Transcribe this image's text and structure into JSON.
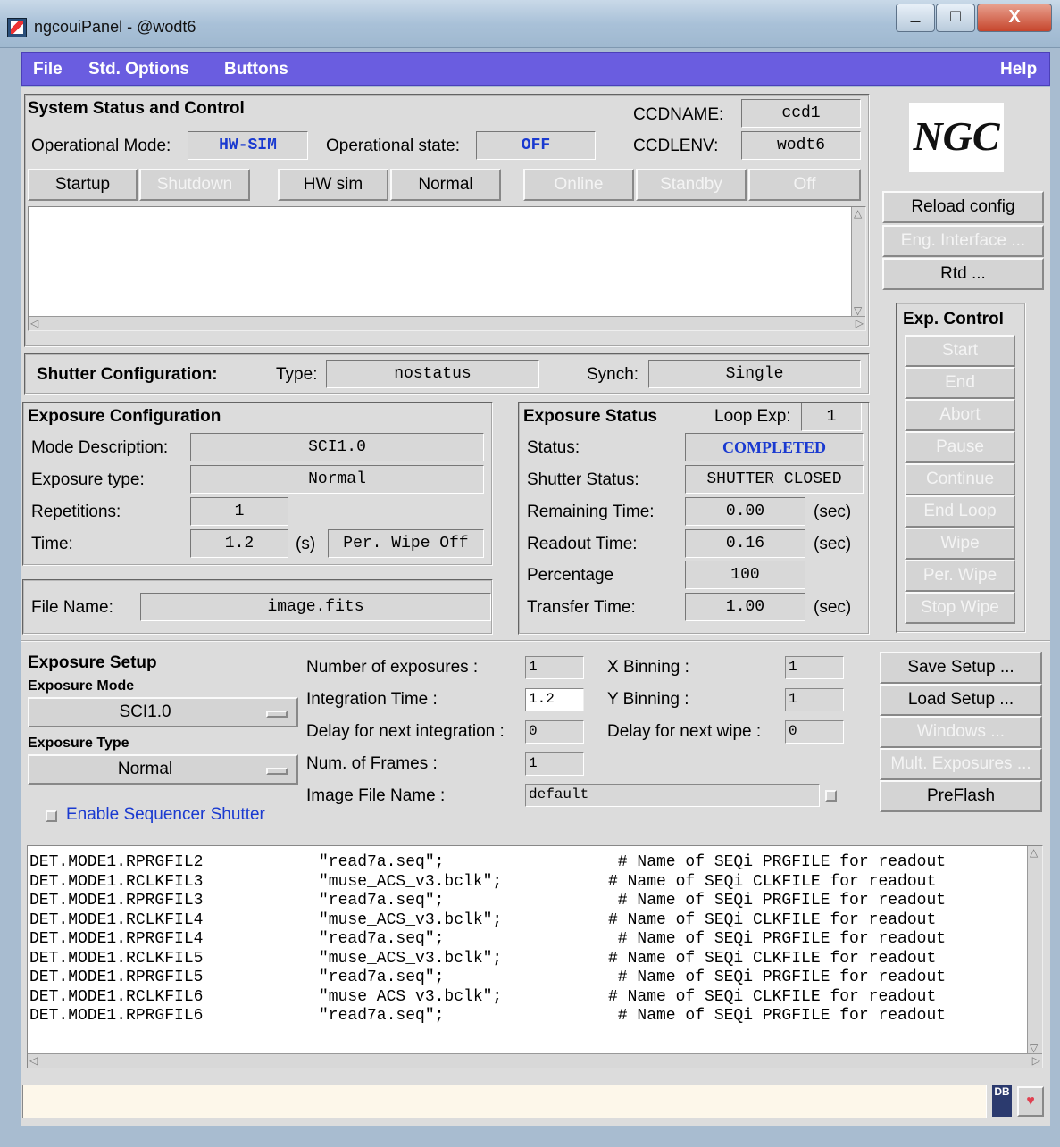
{
  "window": {
    "title": "ngcouiPanel - @wodt6",
    "minimize": "_",
    "maximize": "□",
    "close": "X"
  },
  "menu": {
    "file": "File",
    "std_options": "Std. Options",
    "buttons": "Buttons",
    "help": "Help"
  },
  "system": {
    "heading": "System Status and Control",
    "op_mode_label": "Operational Mode:",
    "op_mode_value": "HW-SIM",
    "op_state_label": "Operational state:",
    "op_state_value": "OFF",
    "ccdname_label": "CCDNAME:",
    "ccdname_value": "ccd1",
    "ccdlenv_label": "CCDLENV:",
    "ccdlenv_value": "wodt6",
    "buttons": {
      "startup": "Startup",
      "shutdown": "Shutdown",
      "hwsim": "HW sim",
      "normal": "Normal",
      "online": "Online",
      "standby": "Standby",
      "off": "Off"
    }
  },
  "logo": "NGC",
  "right_buttons": {
    "reload": "Reload config",
    "eng": "Eng. Interface ...",
    "rtd": "Rtd ..."
  },
  "exp_control": {
    "heading": "Exp. Control",
    "start": "Start",
    "end": "End",
    "abort": "Abort",
    "pause": "Pause",
    "continue": "Continue",
    "end_loop": "End Loop",
    "wipe": "Wipe",
    "per_wipe": "Per. Wipe",
    "stop_wipe": "Stop Wipe"
  },
  "shutter": {
    "heading": "Shutter Configuration:",
    "type_label": "Type:",
    "type_value": "nostatus",
    "synch_label": "Synch:",
    "synch_value": "Single"
  },
  "exp_config": {
    "heading": "Exposure Configuration",
    "mode_label": "Mode Description:",
    "mode_value": "SCI1.0",
    "type_label": "Exposure type:",
    "type_value": "Normal",
    "rep_label": "Repetitions:",
    "rep_value": "1",
    "time_label": "Time:",
    "time_value": "1.2",
    "time_unit": "(s)",
    "perwipe_value": "Per. Wipe Off"
  },
  "file_name": {
    "label": "File Name:",
    "value": "image.fits"
  },
  "exp_status": {
    "heading": "Exposure Status",
    "loop_label": "Loop Exp:",
    "loop_value": "1",
    "status_label": "Status:",
    "status_value": "COMPLETED",
    "shutter_label": "Shutter Status:",
    "shutter_value": "SHUTTER CLOSED",
    "remaining_label": "Remaining Time:",
    "remaining_value": "0.00",
    "readout_label": "Readout Time:",
    "readout_value": "0.16",
    "percentage_label": "Percentage",
    "percentage_value": "100",
    "transfer_label": "Transfer Time:",
    "transfer_value": "1.00",
    "unit": "(sec)"
  },
  "setup": {
    "heading": "Exposure Setup",
    "mode_label": "Exposure Mode",
    "mode_value": "SCI1.0",
    "type_label": "Exposure Type",
    "type_value": "Normal",
    "seq_shutter": "Enable Sequencer Shutter",
    "num_exp_label": "Number of exposures :",
    "num_exp_value": "1",
    "int_time_label": "Integration Time :",
    "int_time_value": "1.2",
    "delay_int_label": "Delay for next integration :",
    "delay_int_value": "0",
    "frames_label": "Num. of Frames :",
    "frames_value": "1",
    "image_file_label": "Image File Name :",
    "image_file_value": "default",
    "xbin_label": "X Binning :",
    "xbin_value": "1",
    "ybin_label": "Y Binning :",
    "ybin_value": "1",
    "delay_wipe_label": "Delay for next wipe :",
    "delay_wipe_value": "0",
    "buttons": {
      "save": "Save Setup ...",
      "load": "Load Setup ...",
      "windows": "Windows ...",
      "mult": "Mult. Exposures ...",
      "preflash": "PreFlash"
    }
  },
  "config_lines": [
    {
      "key": "DET.MODE1.RPRGFIL2",
      "value": "\"read7a.seq\";",
      "comment": " # Name of SEQi PRGFILE for readout"
    },
    {
      "key": "DET.MODE1.RCLKFIL3",
      "value": "\"muse_ACS_v3.bclk\";",
      "comment": "# Name of SEQi CLKFILE for readout"
    },
    {
      "key": "DET.MODE1.RPRGFIL3",
      "value": "\"read7a.seq\";",
      "comment": " # Name of SEQi PRGFILE for readout"
    },
    {
      "key": "DET.MODE1.RCLKFIL4",
      "value": "\"muse_ACS_v3.bclk\";",
      "comment": "# Name of SEQi CLKFILE for readout"
    },
    {
      "key": "DET.MODE1.RPRGFIL4",
      "value": "\"read7a.seq\";",
      "comment": " # Name of SEQi PRGFILE for readout"
    },
    {
      "key": "DET.MODE1.RCLKFIL5",
      "value": "\"muse_ACS_v3.bclk\";",
      "comment": "# Name of SEQi CLKFILE for readout"
    },
    {
      "key": "DET.MODE1.RPRGFIL5",
      "value": "\"read7a.seq\";",
      "comment": " # Name of SEQi PRGFILE for readout"
    },
    {
      "key": "DET.MODE1.RCLKFIL6",
      "value": "\"muse_ACS_v3.bclk\";",
      "comment": "# Name of SEQi CLKFILE for readout"
    },
    {
      "key": "DET.MODE1.RPRGFIL6",
      "value": "\"read7a.seq\";",
      "comment": " # Name of SEQi PRGFILE for readout"
    }
  ],
  "statusbar": {
    "db_icon": "DB",
    "heart_icon": "♥"
  }
}
